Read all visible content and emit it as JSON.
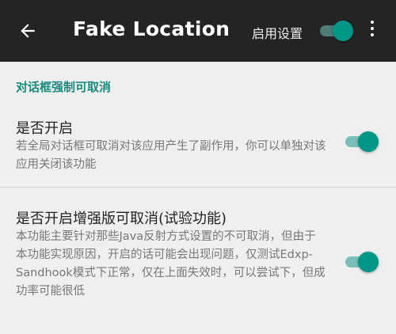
{
  "app_bar": {
    "title": "Fake Location",
    "enable_label": "启用设置",
    "enable_switch_on": true
  },
  "section": {
    "header": "对话框强制可取消"
  },
  "preferences": [
    {
      "title": "是否开启",
      "summary": "若全局对话框可取消对该应用产生了副作用，你可以单独对该应用关闭该功能",
      "enabled": true
    },
    {
      "title": "是否开启增强版可取消(试验功能)",
      "summary": "本功能主要针对那些Java反射方式设置的不可取消，但由于本功能实现原因，开启的话可能会出现问题，仅测试Edxp-Sandhook模式下正常，仅在上面失效时，可以尝试下，但成功率可能很低",
      "enabled": true
    }
  ],
  "colors": {
    "app_bar": "#242424",
    "accent": "#009688",
    "section_header": "#1a8a7d",
    "background": "#efefef"
  },
  "icons": {
    "back": "arrow-left",
    "more": "three-dot-vertical"
  }
}
